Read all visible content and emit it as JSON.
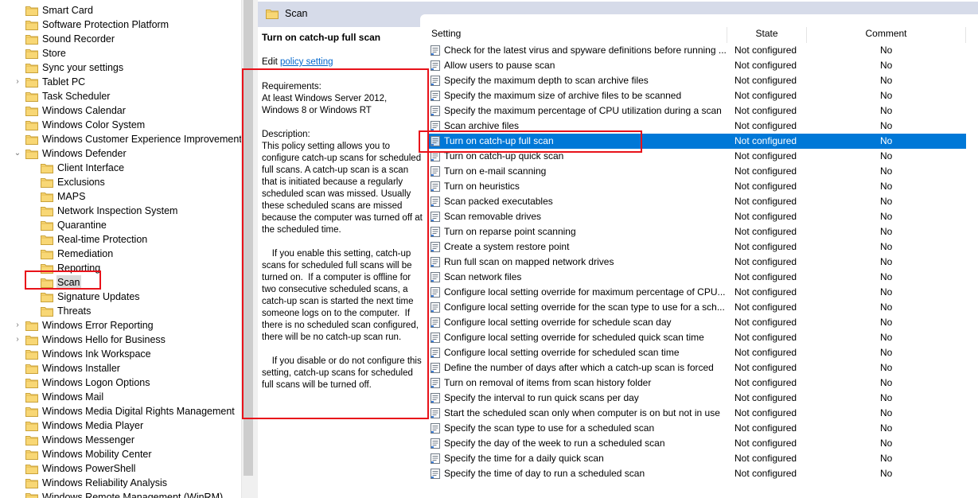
{
  "tree": {
    "items": [
      {
        "label": "Smart Card",
        "indent": 0,
        "expander": ""
      },
      {
        "label": "Software Protection Platform",
        "indent": 0,
        "expander": ""
      },
      {
        "label": "Sound Recorder",
        "indent": 0,
        "expander": ""
      },
      {
        "label": "Store",
        "indent": 0,
        "expander": ""
      },
      {
        "label": "Sync your settings",
        "indent": 0,
        "expander": ""
      },
      {
        "label": "Tablet PC",
        "indent": 0,
        "expander": "›"
      },
      {
        "label": "Task Scheduler",
        "indent": 0,
        "expander": ""
      },
      {
        "label": "Windows Calendar",
        "indent": 0,
        "expander": ""
      },
      {
        "label": "Windows Color System",
        "indent": 0,
        "expander": ""
      },
      {
        "label": "Windows Customer Experience Improvement P",
        "indent": 0,
        "expander": ""
      },
      {
        "label": "Windows Defender",
        "indent": 0,
        "expander": "⌄"
      },
      {
        "label": "Client Interface",
        "indent": 1,
        "expander": ""
      },
      {
        "label": "Exclusions",
        "indent": 1,
        "expander": ""
      },
      {
        "label": "MAPS",
        "indent": 1,
        "expander": ""
      },
      {
        "label": "Network Inspection System",
        "indent": 1,
        "expander": ""
      },
      {
        "label": "Quarantine",
        "indent": 1,
        "expander": ""
      },
      {
        "label": "Real-time Protection",
        "indent": 1,
        "expander": ""
      },
      {
        "label": "Remediation",
        "indent": 1,
        "expander": ""
      },
      {
        "label": "Reporting",
        "indent": 1,
        "expander": ""
      },
      {
        "label": "Scan",
        "indent": 1,
        "expander": "",
        "selected": true
      },
      {
        "label": "Signature Updates",
        "indent": 1,
        "expander": ""
      },
      {
        "label": "Threats",
        "indent": 1,
        "expander": ""
      },
      {
        "label": "Windows Error Reporting",
        "indent": 0,
        "expander": "›"
      },
      {
        "label": "Windows Hello for Business",
        "indent": 0,
        "expander": "›"
      },
      {
        "label": "Windows Ink Workspace",
        "indent": 0,
        "expander": ""
      },
      {
        "label": "Windows Installer",
        "indent": 0,
        "expander": ""
      },
      {
        "label": "Windows Logon Options",
        "indent": 0,
        "expander": ""
      },
      {
        "label": "Windows Mail",
        "indent": 0,
        "expander": ""
      },
      {
        "label": "Windows Media Digital Rights Management",
        "indent": 0,
        "expander": ""
      },
      {
        "label": "Windows Media Player",
        "indent": 0,
        "expander": ""
      },
      {
        "label": "Windows Messenger",
        "indent": 0,
        "expander": ""
      },
      {
        "label": "Windows Mobility Center",
        "indent": 0,
        "expander": ""
      },
      {
        "label": "Windows PowerShell",
        "indent": 0,
        "expander": ""
      },
      {
        "label": "Windows Reliability Analysis",
        "indent": 0,
        "expander": ""
      },
      {
        "label": "Windows Remote Management (WinRM)",
        "indent": 0,
        "expander": ""
      }
    ]
  },
  "header": {
    "title": "Scan"
  },
  "description": {
    "policy_title": "Turn on catch-up full scan",
    "edit_prefix": "Edit ",
    "edit_link": "policy setting",
    "requirements_label": "Requirements:",
    "requirements_text": "At least Windows Server 2012, Windows 8 or Windows RT",
    "description_label": "Description:",
    "description_text": "This policy setting allows you to configure catch-up scans for scheduled full scans. A catch-up scan is a scan that is initiated because a regularly scheduled scan was missed. Usually these scheduled scans are missed because the computer was turned off at the scheduled time.",
    "enable_text": "    If you enable this setting, catch-up scans for scheduled full scans will be turned on.  If a computer is offline for two consecutive scheduled scans, a catch-up scan is started the next time someone logs on to the computer.  If there is no scheduled scan configured, there will be no catch-up scan run.",
    "disable_text": "    If you disable or do not configure this setting, catch-up scans for scheduled full scans will be turned off."
  },
  "list": {
    "columns": {
      "setting": "Setting",
      "state": "State",
      "comment": "Comment"
    },
    "rows": [
      {
        "name": "Check for the latest virus and spyware definitions before running ...",
        "state": "Not configured",
        "comment": "No"
      },
      {
        "name": "Allow users to pause scan",
        "state": "Not configured",
        "comment": "No"
      },
      {
        "name": "Specify the maximum depth to scan archive files",
        "state": "Not configured",
        "comment": "No"
      },
      {
        "name": "Specify the maximum size of archive files to be scanned",
        "state": "Not configured",
        "comment": "No"
      },
      {
        "name": "Specify the maximum percentage of CPU utilization during a scan",
        "state": "Not configured",
        "comment": "No"
      },
      {
        "name": "Scan archive files",
        "state": "Not configured",
        "comment": "No"
      },
      {
        "name": "Turn on catch-up full scan",
        "state": "Not configured",
        "comment": "No",
        "selected": true
      },
      {
        "name": "Turn on catch-up quick scan",
        "state": "Not configured",
        "comment": "No"
      },
      {
        "name": "Turn on e-mail scanning",
        "state": "Not configured",
        "comment": "No"
      },
      {
        "name": "Turn on heuristics",
        "state": "Not configured",
        "comment": "No"
      },
      {
        "name": "Scan packed executables",
        "state": "Not configured",
        "comment": "No"
      },
      {
        "name": "Scan removable drives",
        "state": "Not configured",
        "comment": "No"
      },
      {
        "name": "Turn on reparse point scanning",
        "state": "Not configured",
        "comment": "No"
      },
      {
        "name": "Create a system restore point",
        "state": "Not configured",
        "comment": "No"
      },
      {
        "name": "Run full scan on mapped network drives",
        "state": "Not configured",
        "comment": "No"
      },
      {
        "name": "Scan network files",
        "state": "Not configured",
        "comment": "No"
      },
      {
        "name": "Configure local setting override for maximum percentage of CPU...",
        "state": "Not configured",
        "comment": "No"
      },
      {
        "name": "Configure local setting override for the scan type to use for a sch...",
        "state": "Not configured",
        "comment": "No"
      },
      {
        "name": "Configure local setting override for schedule scan day",
        "state": "Not configured",
        "comment": "No"
      },
      {
        "name": "Configure local setting override for scheduled quick scan time",
        "state": "Not configured",
        "comment": "No"
      },
      {
        "name": "Configure local setting override for scheduled scan time",
        "state": "Not configured",
        "comment": "No"
      },
      {
        "name": "Define the number of days after which a catch-up scan is forced",
        "state": "Not configured",
        "comment": "No"
      },
      {
        "name": "Turn on removal of items from scan history folder",
        "state": "Not configured",
        "comment": "No"
      },
      {
        "name": "Specify the interval to run quick scans per day",
        "state": "Not configured",
        "comment": "No"
      },
      {
        "name": "Start the scheduled scan only when computer is on but not in use",
        "state": "Not configured",
        "comment": "No"
      },
      {
        "name": "Specify the scan type to use for a scheduled scan",
        "state": "Not configured",
        "comment": "No"
      },
      {
        "name": "Specify the day of the week to run a scheduled scan",
        "state": "Not configured",
        "comment": "No"
      },
      {
        "name": "Specify the time for a daily quick scan",
        "state": "Not configured",
        "comment": "No"
      },
      {
        "name": "Specify the time of day to run a scheduled scan",
        "state": "Not configured",
        "comment": "No"
      }
    ]
  },
  "colors": {
    "selection": "#0078d7",
    "highlight": "#e8121a",
    "header_band": "#d6dbe9",
    "link": "#0066cc"
  },
  "icons": {
    "folder": "folder-icon",
    "policy": "policy-setting-icon",
    "expand": "chevron-right-icon",
    "collapse": "chevron-down-icon"
  }
}
